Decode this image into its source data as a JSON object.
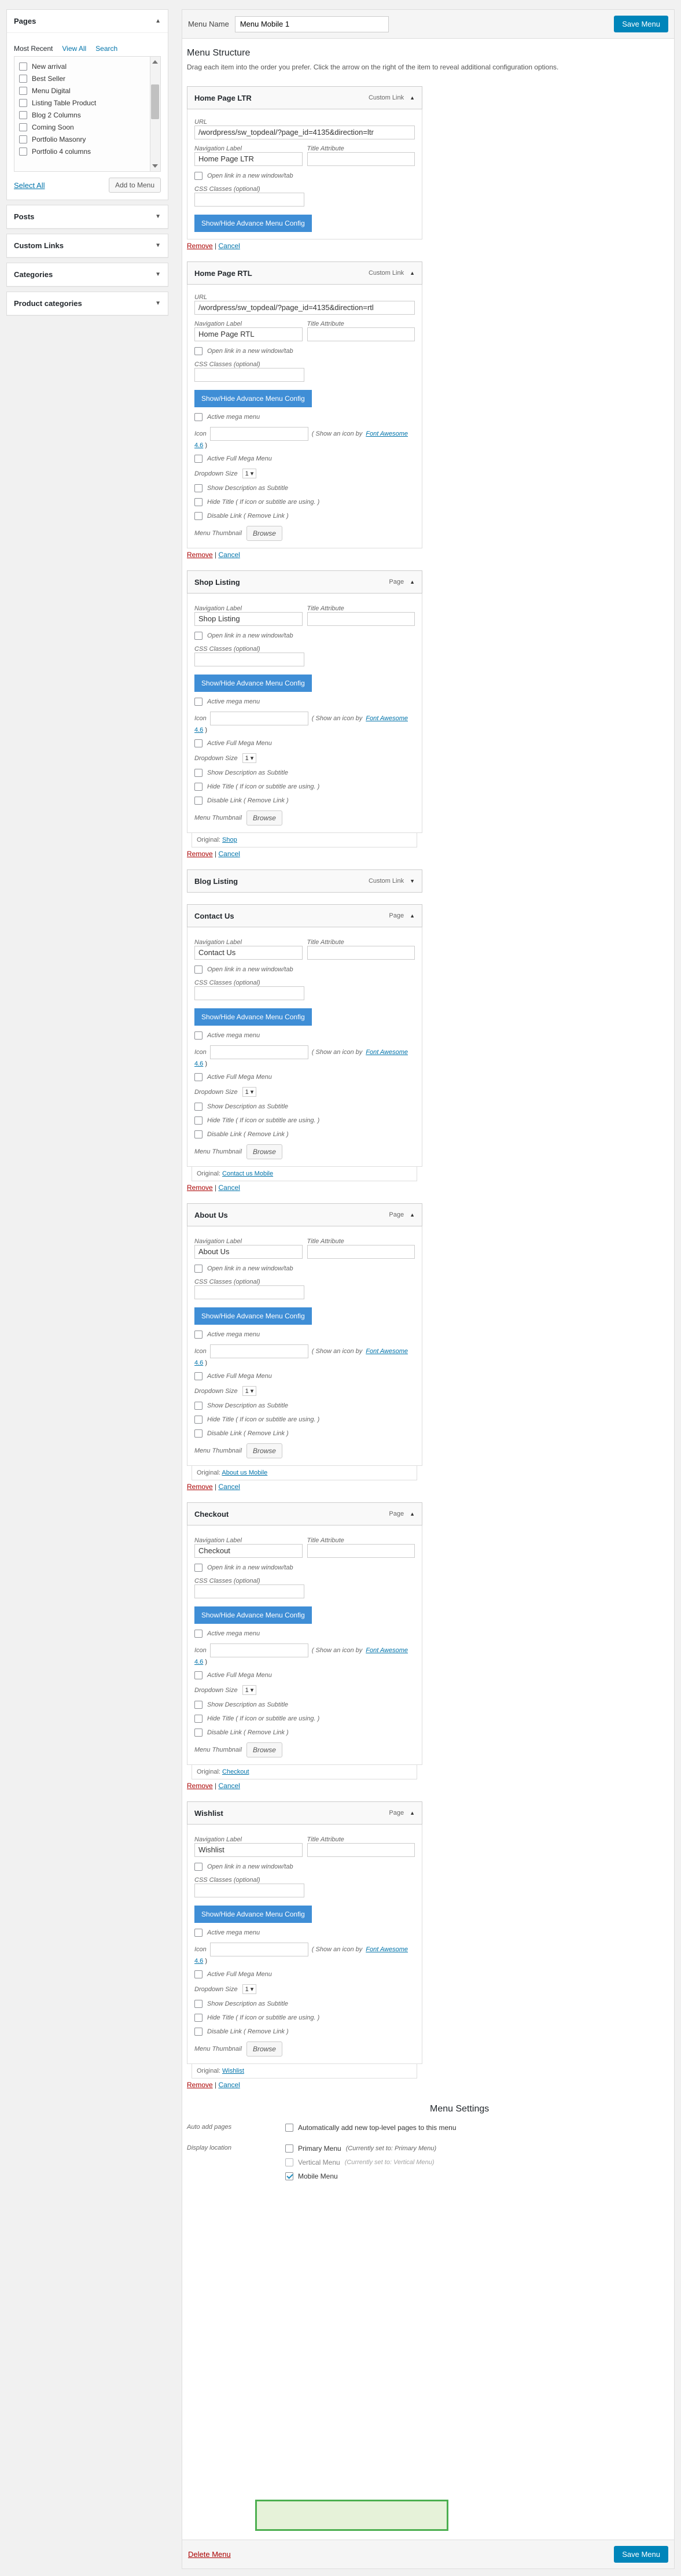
{
  "left": {
    "pages": {
      "title": "Pages",
      "tabs": [
        "Most Recent",
        "View All",
        "Search"
      ],
      "items": [
        "New arrival",
        "Best Seller",
        "Menu Digital",
        "Listing Table Product",
        "Blog 2 Columns",
        "Coming Soon",
        "Portfolio Masonry",
        "Portfolio 4 columns"
      ],
      "select_all": "Select All",
      "add_button": "Add to Menu"
    },
    "panels": [
      "Posts",
      "Custom Links",
      "Categories",
      "Product categories"
    ]
  },
  "header": {
    "menu_name_label": "Menu Name",
    "menu_name_value": "Menu Mobile 1",
    "save_button": "Save Menu"
  },
  "structure": {
    "title": "Menu Structure",
    "description": "Drag each item into the order you prefer. Click the arrow on the right of the item to reveal additional configuration options."
  },
  "labels": {
    "url": "URL",
    "navigation_label": "Navigation Label",
    "title_attribute": "Title Attribute",
    "open_new_window": "Open link in a new window/tab",
    "css_classes": "CSS Classes (optional)",
    "config_button": "Show/Hide Advance Menu Config",
    "active_mega": "Active mega menu",
    "icon": "Icon",
    "icon_hint": "( Show an icon by",
    "font_awesome": "Font Awesome",
    "fa_version": "4.6",
    "active_full_mega": "Active Full Mega Menu",
    "dropdown_size": "Dropdown Size",
    "dropdown_value": "1",
    "show_desc": "Show Description as Subtitle",
    "hide_title": "Hide Title ( If icon or subtitle are using. )",
    "disable_link": "Disable Link ( Remove Link )",
    "menu_thumbnail": "Menu Thumbnail",
    "browse": "Browse",
    "remove": "Remove",
    "cancel": "Cancel",
    "original": "Original:"
  },
  "items": [
    {
      "title": "Home Page LTR",
      "type": "Custom Link",
      "url": "/wordpress/sw_topdeal/?page_id=4135&direction=ltr",
      "nav_label": "Home Page LTR",
      "advanced": false,
      "original": ""
    },
    {
      "title": "Home Page RTL",
      "type": "Custom Link",
      "url": "/wordpress/sw_topdeal/?page_id=4135&direction=rtl",
      "nav_label": "Home Page RTL",
      "advanced": true,
      "original": ""
    },
    {
      "title": "Shop Listing",
      "type": "Page",
      "url": "",
      "nav_label": "Shop Listing",
      "advanced": true,
      "original": "Shop"
    },
    {
      "title": "Blog Listing",
      "type": "Custom Link",
      "collapsed": true
    },
    {
      "title": "Contact Us",
      "type": "Page",
      "url": "",
      "nav_label": "Contact Us",
      "advanced": true,
      "original": "Contact us Mobile"
    },
    {
      "title": "About Us",
      "type": "Page",
      "url": "",
      "nav_label": "About Us",
      "advanced": true,
      "original": "About us Mobile"
    },
    {
      "title": "Checkout",
      "type": "Page",
      "url": "",
      "nav_label": "Checkout",
      "advanced": true,
      "original": "Checkout"
    },
    {
      "title": "Wishlist",
      "type": "Page",
      "url": "",
      "nav_label": "Wishlist",
      "advanced": true,
      "original": "Wishlist"
    }
  ],
  "settings": {
    "title": "Menu Settings",
    "auto_add_label": "Auto add pages",
    "auto_add_option": "Automatically add new top-level pages to this menu",
    "display_label": "Display location",
    "primary": "Primary Menu",
    "primary_note": "(Currently set to: Primary Menu)",
    "vertical": "Vertical Menu",
    "vertical_note": "(Currently set to: Vertical Menu)",
    "mobile": "Mobile Menu"
  },
  "footer": {
    "delete": "Delete Menu",
    "save": "Save Menu"
  }
}
